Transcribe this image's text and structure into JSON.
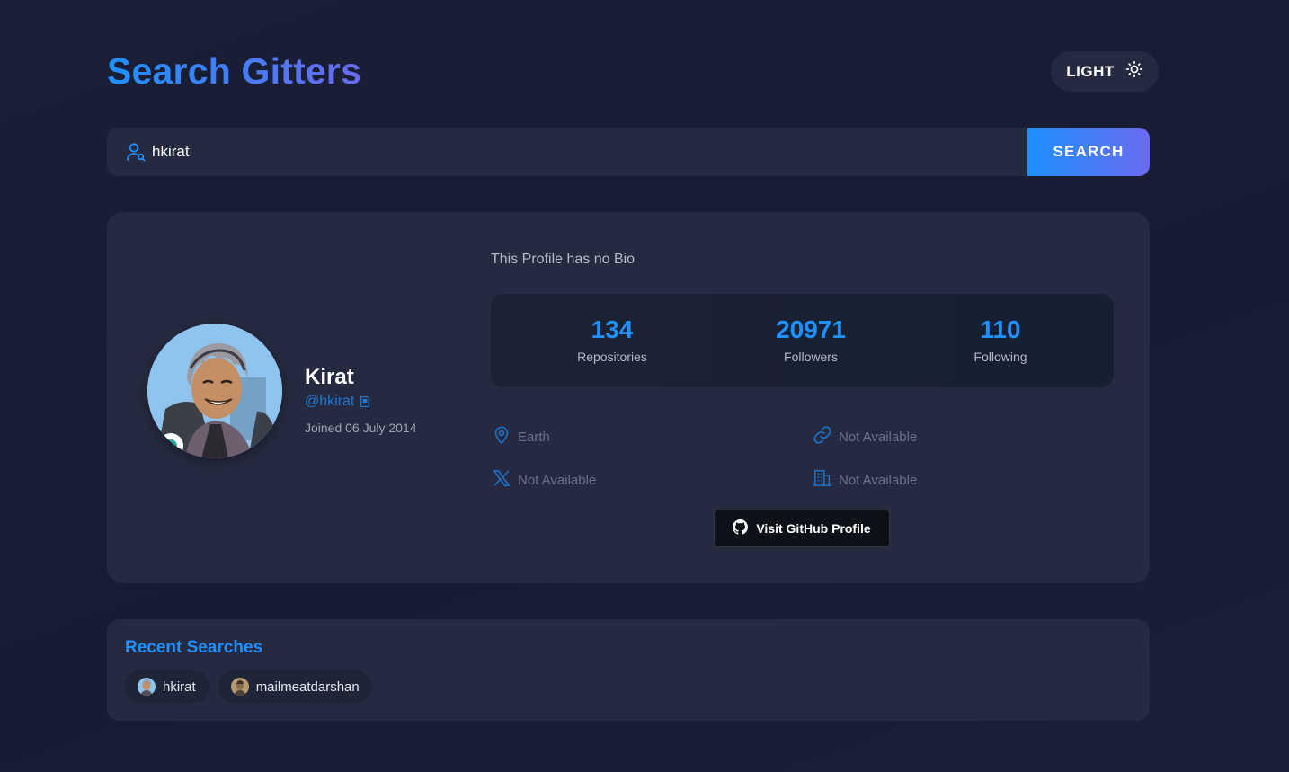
{
  "header": {
    "title": "Search Gitters",
    "theme_toggle_label": "LIGHT"
  },
  "search": {
    "value": "hkirat",
    "placeholder": "",
    "button_label": "SEARCH"
  },
  "profile": {
    "name": "Kirat",
    "handle": "@hkirat",
    "joined": "Joined 06 July 2014",
    "bio": "This Profile has no Bio",
    "stats": [
      {
        "value": "134",
        "label": "Repositories"
      },
      {
        "value": "20971",
        "label": "Followers"
      },
      {
        "value": "110",
        "label": "Following"
      }
    ],
    "location": "Earth",
    "website": "Not Available",
    "twitter": "Not Available",
    "company": "Not Available",
    "visit_button_label": "Visit GitHub Profile"
  },
  "recent": {
    "heading": "Recent Searches",
    "items": [
      {
        "label": "hkirat",
        "avatar_icon": "anime-avatar"
      },
      {
        "label": "mailmeatdarshan",
        "avatar_icon": "photo-avatar"
      }
    ]
  },
  "colors": {
    "accent": "#1e90ff",
    "accent_gradient_end": "#6a6af0",
    "card_bg": "#262a40",
    "page_bg": "#1a1e35"
  }
}
